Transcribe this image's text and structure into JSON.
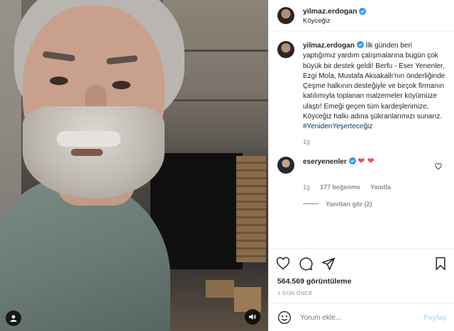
{
  "post": {
    "username": "yilmaz.erdogan",
    "location": "Köyceğiz",
    "caption_text": "İlk günden beri yaptığımız yardım çalışmalarına bugün çok büyük bir destek geldi! Berfu - Eser Yenenler, Ezgi Mola, Mustafa Aksakallı'nın önderliğinde Çeşme halkının desteğiyle ve birçok firmanın katılımıyla toplanan malzemeler köyümüze ulaştı! Emeği geçen tüm kardeşlerimize, Köyceğiz halkı adına şükranlarımızı sunarız.",
    "hashtag": "#YenidenYeşerteceğiz",
    "caption_age": "1g",
    "views_count": "564.569 görüntüleme",
    "date": "1 GÜN ÖNCE"
  },
  "reply": {
    "username": "eseryenenler",
    "hearts": "❤ ❤",
    "age": "1g",
    "likes": "177 beğenme",
    "reply_label": "Yanıtla",
    "view_replies": "Yanıtları gör (2)"
  },
  "comment_box": {
    "placeholder": "Yorum ekle...",
    "post_label": "Paylaş"
  },
  "colors": {
    "verified": "#3897f0",
    "hashtag": "#00376b",
    "heart": "#ed4956",
    "post_disabled": "#b2dffc"
  },
  "icons": [
    "user-tag-icon",
    "sound-icon",
    "verified-badge-icon",
    "heart-icon",
    "comment-icon",
    "share-icon",
    "bookmark-icon",
    "smiley-icon"
  ]
}
